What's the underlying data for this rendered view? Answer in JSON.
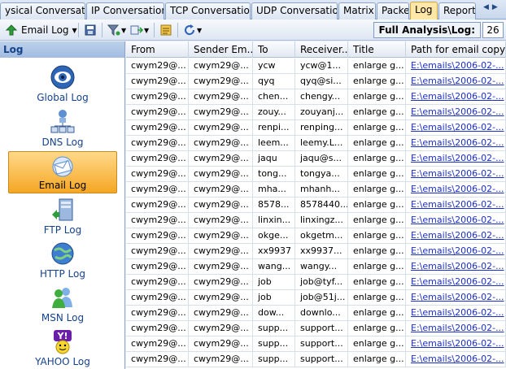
{
  "tabs": [
    {
      "label": "ysical Conversation"
    },
    {
      "label": "IP Conversation"
    },
    {
      "label": "TCP Conversation"
    },
    {
      "label": "UDP Conversation"
    },
    {
      "label": "Matrix"
    },
    {
      "label": "Packet"
    },
    {
      "label": "Log"
    },
    {
      "label": "Report"
    }
  ],
  "active_tab": "Log",
  "toolbar": {
    "email_log_label": "Email Log",
    "full_analysis_label": "Full Analysis\\Log:",
    "log_count": "26"
  },
  "left_panel": {
    "title": "Log",
    "items": [
      {
        "label": "Global Log",
        "icon": "globe-eye-icon"
      },
      {
        "label": "DNS Log",
        "icon": "network-tree-icon"
      },
      {
        "label": "Email Log",
        "icon": "email-envelope-icon"
      },
      {
        "label": "FTP Log",
        "icon": "ftp-server-icon"
      },
      {
        "label": "HTTP Log",
        "icon": "http-globe-icon"
      },
      {
        "label": "MSN Log",
        "icon": "msn-buddy-icon"
      },
      {
        "label": "YAHOO Log",
        "icon": "yahoo-icon"
      }
    ],
    "active_item": "Email Log"
  },
  "grid": {
    "columns": [
      "From",
      "Sender Em...",
      "To",
      "Receiver...",
      "Title",
      "Path for email copy"
    ],
    "rows": [
      [
        "cwym29@...",
        "cwym29@...",
        "ycw",
        "ycw@1...",
        "enlarge g...",
        "E:\\emails\\2006-02-..."
      ],
      [
        "cwym29@...",
        "cwym29@...",
        "qyq",
        "qyq@si...",
        "enlarge g...",
        "E:\\emails\\2006-02-..."
      ],
      [
        "cwym29@...",
        "cwym29@...",
        "chen...",
        "chengy...",
        "enlarge g...",
        "E:\\emails\\2006-02-..."
      ],
      [
        "cwym29@...",
        "cwym29@...",
        "zouy...",
        "zouyanj...",
        "enlarge g...",
        "E:\\emails\\2006-02-..."
      ],
      [
        "cwym29@...",
        "cwym29@...",
        "renpi...",
        "renping...",
        "enlarge g...",
        "E:\\emails\\2006-02-..."
      ],
      [
        "cwym29@...",
        "cwym29@...",
        "leem...",
        "leemy.L...",
        "enlarge g...",
        "E:\\emails\\2006-02-..."
      ],
      [
        "cwym29@...",
        "cwym29@...",
        "jaqu",
        "jaqu@s...",
        "enlarge g...",
        "E:\\emails\\2006-02-..."
      ],
      [
        "cwym29@...",
        "cwym29@...",
        "tong...",
        "tongya...",
        "enlarge g...",
        "E:\\emails\\2006-02-..."
      ],
      [
        "cwym29@...",
        "cwym29@...",
        "mha...",
        "mhanh...",
        "enlarge g...",
        "E:\\emails\\2006-02-..."
      ],
      [
        "cwym29@...",
        "cwym29@...",
        "8578...",
        "8578440...",
        "enlarge g...",
        "E:\\emails\\2006-02-..."
      ],
      [
        "cwym29@...",
        "cwym29@...",
        "linxin...",
        "linxingz...",
        "enlarge g...",
        "E:\\emails\\2006-02-..."
      ],
      [
        "cwym29@...",
        "cwym29@...",
        "okge...",
        "okgetm...",
        "enlarge g...",
        "E:\\emails\\2006-02-..."
      ],
      [
        "cwym29@...",
        "cwym29@...",
        "xx9937",
        "xx9937...",
        "enlarge g...",
        "E:\\emails\\2006-02-..."
      ],
      [
        "cwym29@...",
        "cwym29@...",
        "wang...",
        "wangy...",
        "enlarge g...",
        "E:\\emails\\2006-02-..."
      ],
      [
        "cwym29@...",
        "cwym29@...",
        "job",
        "job@tyf...",
        "enlarge g...",
        "E:\\emails\\2006-02-..."
      ],
      [
        "cwym29@...",
        "cwym29@...",
        "job",
        "job@51j...",
        "enlarge g...",
        "E:\\emails\\2006-02-..."
      ],
      [
        "cwym29@...",
        "cwym29@...",
        "dow...",
        "downlo...",
        "enlarge g...",
        "E:\\emails\\2006-02-..."
      ],
      [
        "cwym29@...",
        "cwym29@...",
        "supp...",
        "support...",
        "enlarge g...",
        "E:\\emails\\2006-02-..."
      ],
      [
        "cwym29@...",
        "cwym29@...",
        "supp...",
        "support...",
        "enlarge g...",
        "E:\\emails\\2006-02-..."
      ],
      [
        "cwym29@...",
        "cwym29@...",
        "supp...",
        "support...",
        "enlarge g...",
        "E:\\emails\\2006-02-..."
      ]
    ]
  },
  "colors": {
    "active_tab": "#ffe7a8",
    "active_item": "#f5a623",
    "link": "#1a2fc9",
    "header_text": "#15428b"
  }
}
